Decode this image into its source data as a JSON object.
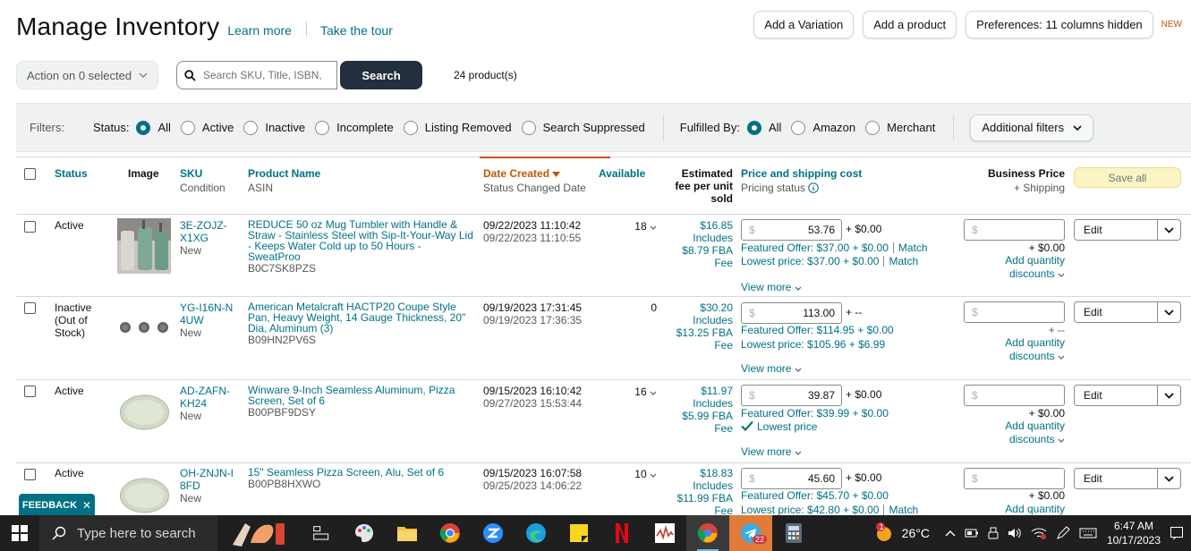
{
  "header": {
    "title": "Manage Inventory",
    "learn_more": "Learn more",
    "take_tour": "Take the tour"
  },
  "top_buttons": {
    "add_variation": "Add a Variation",
    "add_product": "Add a product",
    "preferences": "Preferences: 11 columns hidden",
    "new_badge": "NEW"
  },
  "toolbar": {
    "action": "Action on 0 selected",
    "search_placeholder": "Search SKU, Title, ISBN,",
    "search_button": "Search",
    "product_count": "24 product(s)"
  },
  "filters": {
    "label": "Filters:",
    "status_label": "Status:",
    "status_options": [
      "All",
      "Active",
      "Inactive",
      "Incomplete",
      "Listing Removed",
      "Search Suppressed"
    ],
    "status_selected": "All",
    "fulfilled_label": "Fulfilled By:",
    "fulfilled_options": [
      "All",
      "Amazon",
      "Merchant"
    ],
    "fulfilled_selected": "All",
    "additional": "Additional filters"
  },
  "columns": {
    "status": "Status",
    "image": "Image",
    "sku": "SKU",
    "sku_sub": "Condition",
    "product_name": "Product Name",
    "product_sub": "ASIN",
    "date_created": "Date Created",
    "date_sub": "Status Changed Date",
    "available": "Available",
    "fee_1": "Estimated",
    "fee_2": "fee per unit",
    "fee_3": "sold",
    "price": "Price and shipping cost",
    "price_sub": "Pricing status",
    "business": "Business Price",
    "business_sub": "+ Shipping",
    "save_all": "Save all"
  },
  "rows": [
    {
      "status": [
        "Active"
      ],
      "image": "tumbler-photo",
      "sku": "3E-ZOJZ-X1XG",
      "condition": "New",
      "name": "REDUCE 50 oz Mug Tumbler with Handle & Straw - Stainless Steel with Sip-It-Your-Way Lid - Keeps Water Cold up to 50 Hours - SweatProo",
      "asin": "B0C7SK8PZS",
      "created": "09/22/2023 11:10:42",
      "changed": "09/22/2023 11:10:55",
      "available": "18",
      "fee": [
        "$16.85",
        "Includes",
        "$8.79 FBA",
        "Fee"
      ],
      "price": "53.76",
      "shipping": "+ $0.00",
      "offer1": "Featured Offer: $37.00 + $0.00",
      "offer1_link": "Match",
      "offer2": "Lowest price: $37.00 + $0.00",
      "offer2_link": "Match",
      "view_more": "View more",
      "bp_currency": "$",
      "bp_ship": "+ $0.00",
      "bp_disc": [
        "Add quantity",
        "discounts"
      ],
      "edit": "Edit"
    },
    {
      "status": [
        "Inactive",
        "(Out of",
        "Stock)"
      ],
      "image": "pizza-pans-photo",
      "sku": "YG-I16N-N4UW",
      "condition": "New",
      "name": "American Metalcraft HACTP20 Coupe Style Pan, Heavy Weight, 14 Gauge Thickness, 20\" Dia, Aluminum (3)",
      "asin": "B09HN2PV6S",
      "created": "09/19/2023 17:31:45",
      "changed": "09/19/2023 17:36:35",
      "available": "0",
      "fee": [
        "$30.20",
        "Includes",
        "$13.25 FBA",
        "Fee"
      ],
      "price": "113.00",
      "shipping": "+ --",
      "offer1": "Featured Offer: $114.95 + $0.00",
      "offer1_link": "",
      "offer2": "Lowest price: $105.96 + $6.99",
      "offer2_link": "",
      "view_more": "View more",
      "bp_currency": "$",
      "bp_ship": "+ --",
      "bp_disc": [
        "Add quantity",
        "discounts"
      ],
      "edit": "Edit"
    },
    {
      "status": [
        "Active"
      ],
      "image": "pizza-pan-photo",
      "sku": "AD-ZAFN-KH24",
      "condition": "New",
      "name": "Winware 9-Inch Seamless Aluminum, Pizza Screen, Set of 6",
      "asin": "B00PBF9DSY",
      "created": "09/15/2023 16:10:42",
      "changed": "09/27/2023 15:53:44",
      "available": "16",
      "fee": [
        "$11.97",
        "Includes",
        "$5.99 FBA",
        "Fee"
      ],
      "price": "39.87",
      "shipping": "+ $0.00",
      "offer1": "Featured Offer: $39.99 + $0.00",
      "offer1_link": "",
      "offer2": "Lowest price",
      "offer2_link": "",
      "view_more": "View more",
      "bp_currency": "$",
      "bp_ship": "+ $0.00",
      "bp_disc": [
        "Add quantity",
        "discounts"
      ],
      "edit": "Edit"
    },
    {
      "status": [
        "Active"
      ],
      "image": "pizza-screen-photo",
      "sku": "OH-ZNJN-I8FD",
      "condition": "New",
      "name": "15\" Seamless Pizza Screen, Alu, Set of 6",
      "asin": "B00PB8HXWO",
      "created": "09/15/2023 16:07:58",
      "changed": "09/25/2023 14:06:22",
      "available": "10",
      "fee": [
        "$18.83",
        "Includes",
        "$11.99 FBA",
        "Fee"
      ],
      "price": "45.60",
      "shipping": "+ $0.00",
      "offer1": "Featured Offer: $45.70 + $0.00",
      "offer1_link": "",
      "offer2": "Lowest price: $42.80 + $0.00",
      "offer2_link": "Match",
      "view_more": "",
      "bp_currency": "$",
      "bp_ship": "+ $0.00",
      "bp_disc": [
        "Add quantity",
        ""
      ],
      "edit": "Edit"
    }
  ],
  "feedback": "FEEDBACK",
  "taskbar": {
    "search_placeholder": "Type here to search",
    "temperature": "26°C",
    "time": "6:47 AM",
    "date": "10/17/2023",
    "badge_count": "22",
    "weather_alert": "1"
  },
  "colors": {
    "link": "#007185",
    "sort_accent": "#c45500",
    "search_button": "#232f3e",
    "taskbar": "#1f1f1f",
    "feedback": "#007185"
  }
}
